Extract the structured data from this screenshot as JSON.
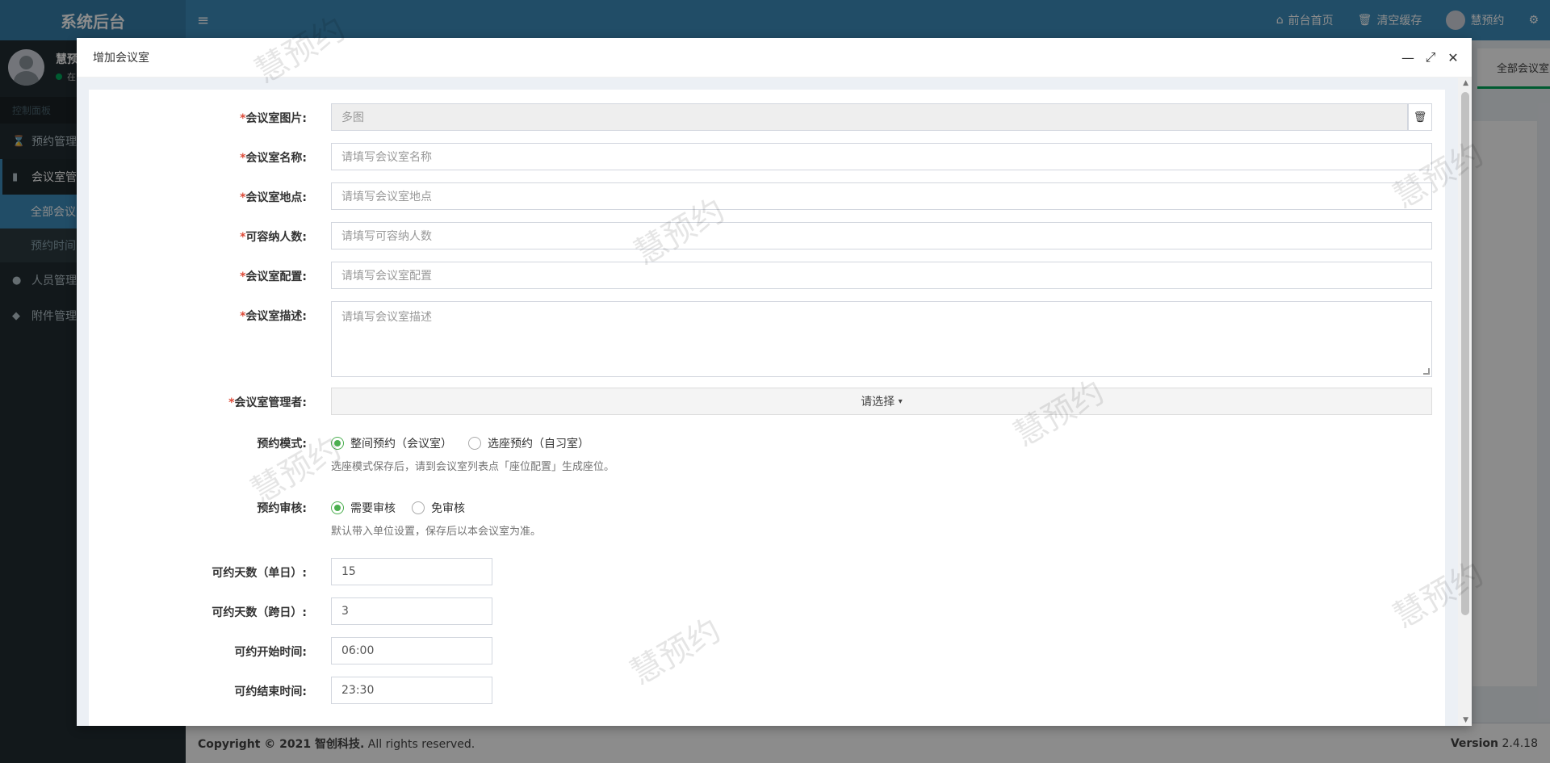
{
  "app": {
    "logo": "系统后台",
    "user_name": "慧预",
    "user_status": "在",
    "menu_header": "控制面板",
    "menu": [
      {
        "label": "预约管理"
      },
      {
        "label": "会议室管"
      },
      {
        "label": "全部会议"
      },
      {
        "label": "预约时间"
      },
      {
        "label": "人员管理"
      },
      {
        "label": "附件管理"
      }
    ],
    "top_links": [
      "前台首页",
      "清空缓存"
    ],
    "top_user": "慧预约",
    "tab_label": "全部会议室",
    "footer_copyright_bold": "Copyright © 2021 智创科技.",
    "footer_copyright_rest": " All rights reserved.",
    "footer_version_label": "Version",
    "footer_version": "2.4.18"
  },
  "modal": {
    "title": "增加会议室",
    "watermark": "慧预约",
    "fields": {
      "image": {
        "label": "会议室图片:",
        "placeholder": "多图"
      },
      "name": {
        "label": "会议室名称:",
        "placeholder": "请填写会议室名称"
      },
      "location": {
        "label": "会议室地点:",
        "placeholder": "请填写会议室地点"
      },
      "capacity": {
        "label": "可容纳人数:",
        "placeholder": "请填写可容纳人数"
      },
      "config": {
        "label": "会议室配置:",
        "placeholder": "请填写会议室配置"
      },
      "description": {
        "label": "会议室描述:",
        "placeholder": "请填写会议室描述"
      },
      "manager": {
        "label": "会议室管理者:",
        "button": "请选择"
      },
      "mode": {
        "label": "预约模式:",
        "options": [
          "整间预约（会议室）",
          "选座预约（自习室）"
        ],
        "selected": 0,
        "help": "选座模式保存后，请到会议室列表点「座位配置」生成座位。"
      },
      "review": {
        "label": "预约审核:",
        "options": [
          "需要审核",
          "免审核"
        ],
        "selected": 0,
        "help": "默认带入单位设置，保存后以本会议室为准。"
      },
      "days_single": {
        "label": "可约天数（单日）:",
        "value": "15"
      },
      "days_multi": {
        "label": "可约天数（跨日）:",
        "value": "3"
      },
      "start_time": {
        "label": "可约开始时间:",
        "value": "06:00"
      },
      "end_time": {
        "label": "可约结束时间:",
        "value": "23:30"
      }
    }
  },
  "required_mark": "*"
}
